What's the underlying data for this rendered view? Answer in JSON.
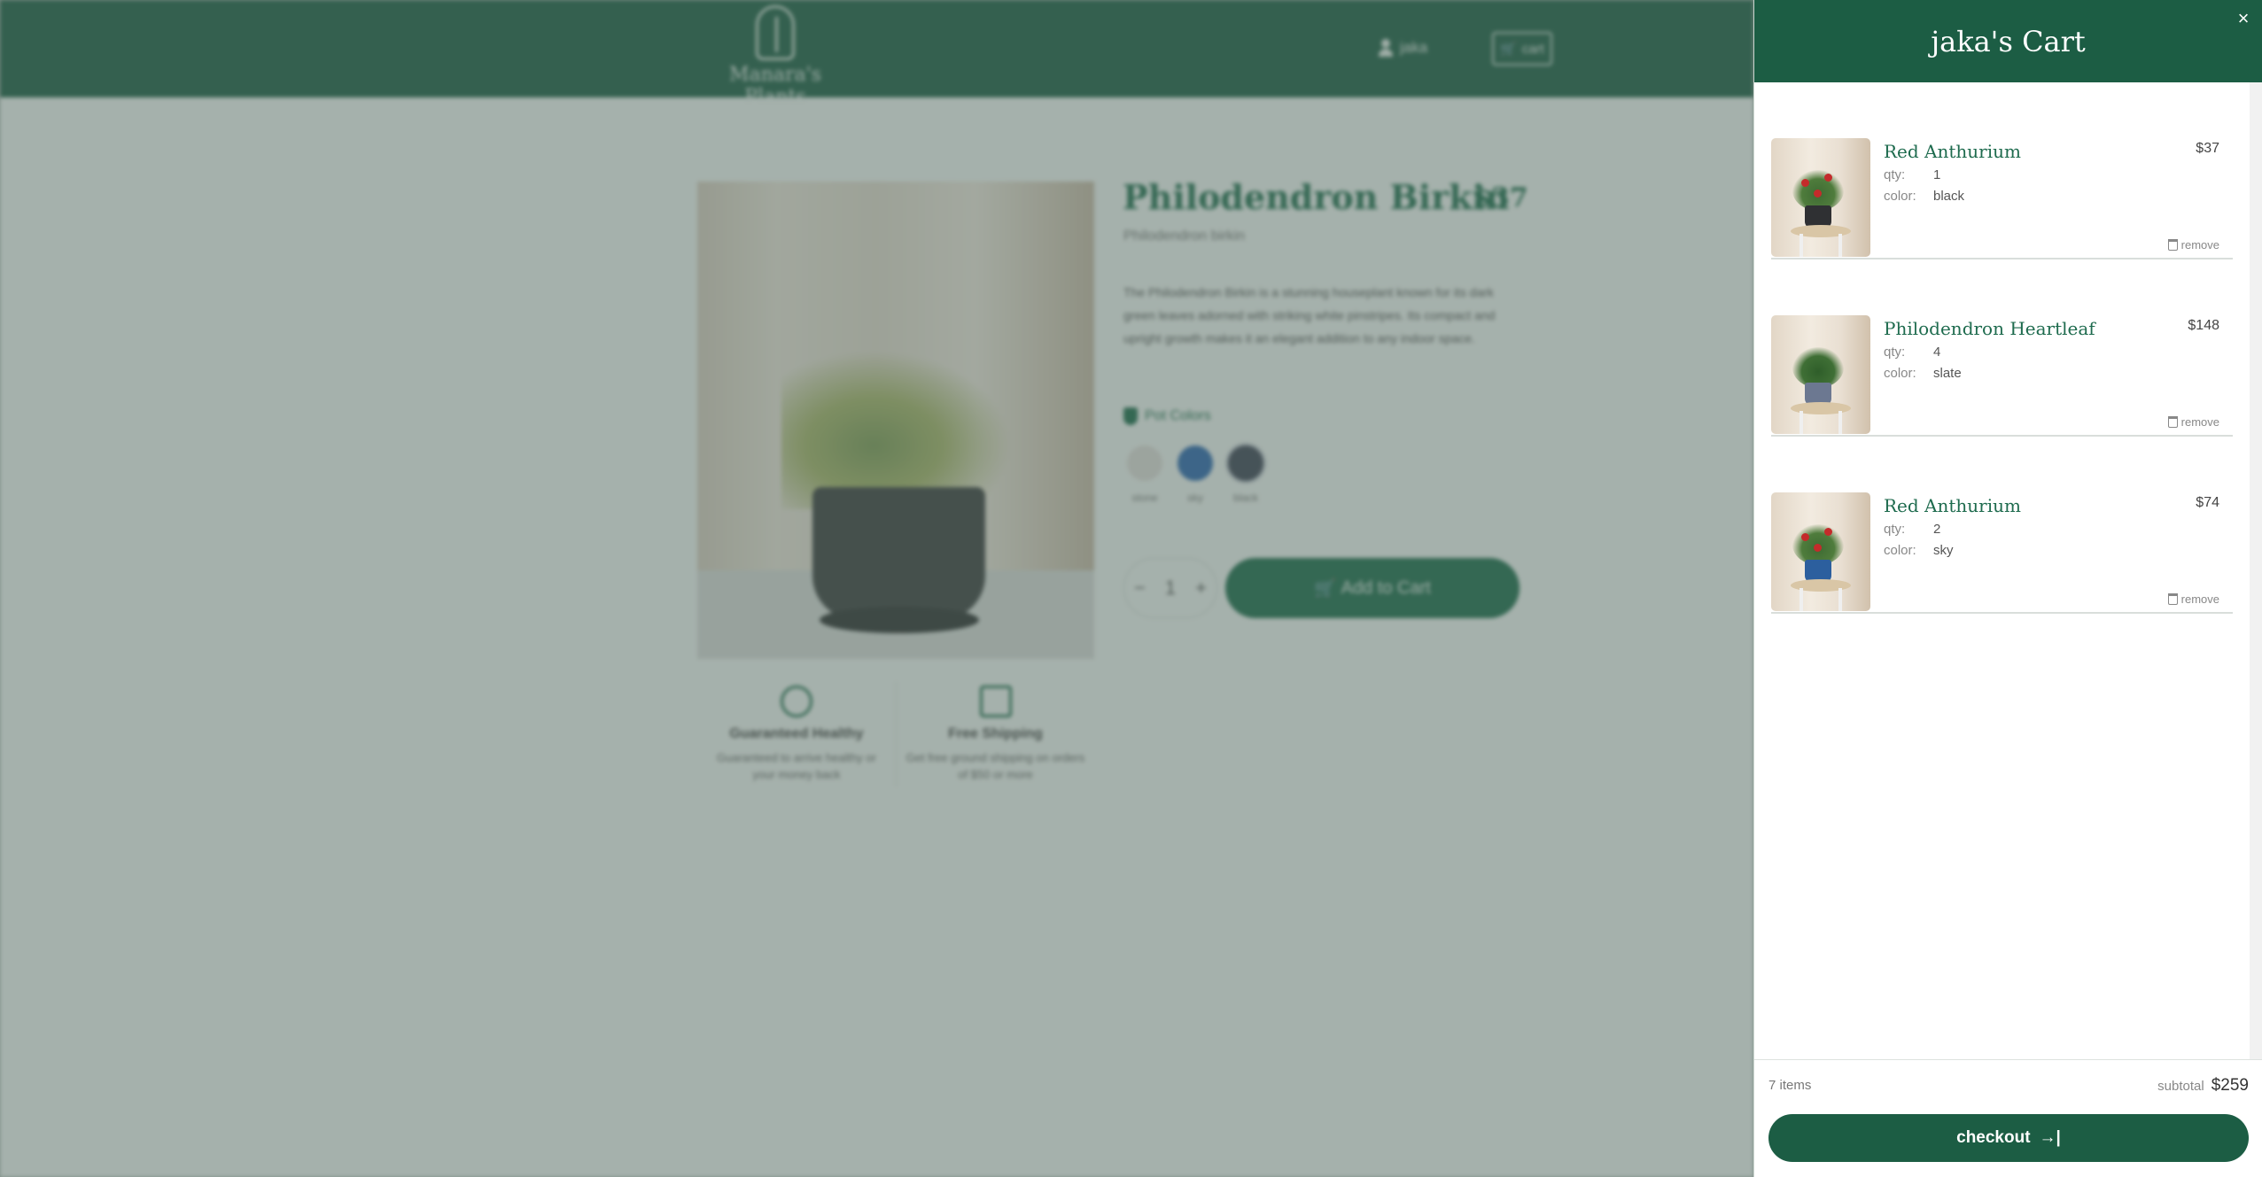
{
  "header": {
    "brand": "Manara's Plants",
    "user_label": "jaka",
    "cart_label": "cart"
  },
  "product": {
    "title": "Philodendron Birkin",
    "price": "$37",
    "latin": "Philodendron birkin",
    "description": "The Philodendron Birkin is a stunning houseplant known for its dark green leaves adorned with striking white pinstripes. Its compact and upright growth makes it an elegant addition to any indoor space.",
    "pot_colors_label": "Pot Colors",
    "swatches": [
      {
        "label": "stone",
        "color": "#e3dedb"
      },
      {
        "label": "sky",
        "color": "#2c67b0"
      },
      {
        "label": "black",
        "color": "#3f4455"
      }
    ],
    "quantity": "1",
    "minus": "−",
    "plus": "+",
    "add_to_cart": "Add to Cart",
    "features": [
      {
        "title": "Guaranteed Healthy",
        "text": "Guaranteed to arrive healthy or your money back"
      },
      {
        "title": "Free Shipping",
        "text": "Get free ground shipping on orders of $50 or more"
      }
    ]
  },
  "cart": {
    "title": "jaka's Cart",
    "close": "×",
    "qty_key": "qty:",
    "color_key": "color:",
    "remove_label": "remove",
    "items": [
      {
        "name": "Red Anthurium",
        "price": "$37",
        "qty": "1",
        "color": "black",
        "pot_color": "#2f3033"
      },
      {
        "name": "Philodendron Heartleaf",
        "price": "$148",
        "qty": "4",
        "color": "slate",
        "pot_color": "#6c7891"
      },
      {
        "name": "Red Anthurium",
        "price": "$74",
        "qty": "2",
        "color": "sky",
        "pot_color": "#2c5f9e"
      }
    ],
    "item_count": "7 items",
    "subtotal_label": "subtotal",
    "subtotal": "$259",
    "checkout": "checkout",
    "checkout_icon": "→|"
  },
  "colors": {
    "brand_green": "#1c5d44",
    "accent_green": "#1e6b4e"
  }
}
